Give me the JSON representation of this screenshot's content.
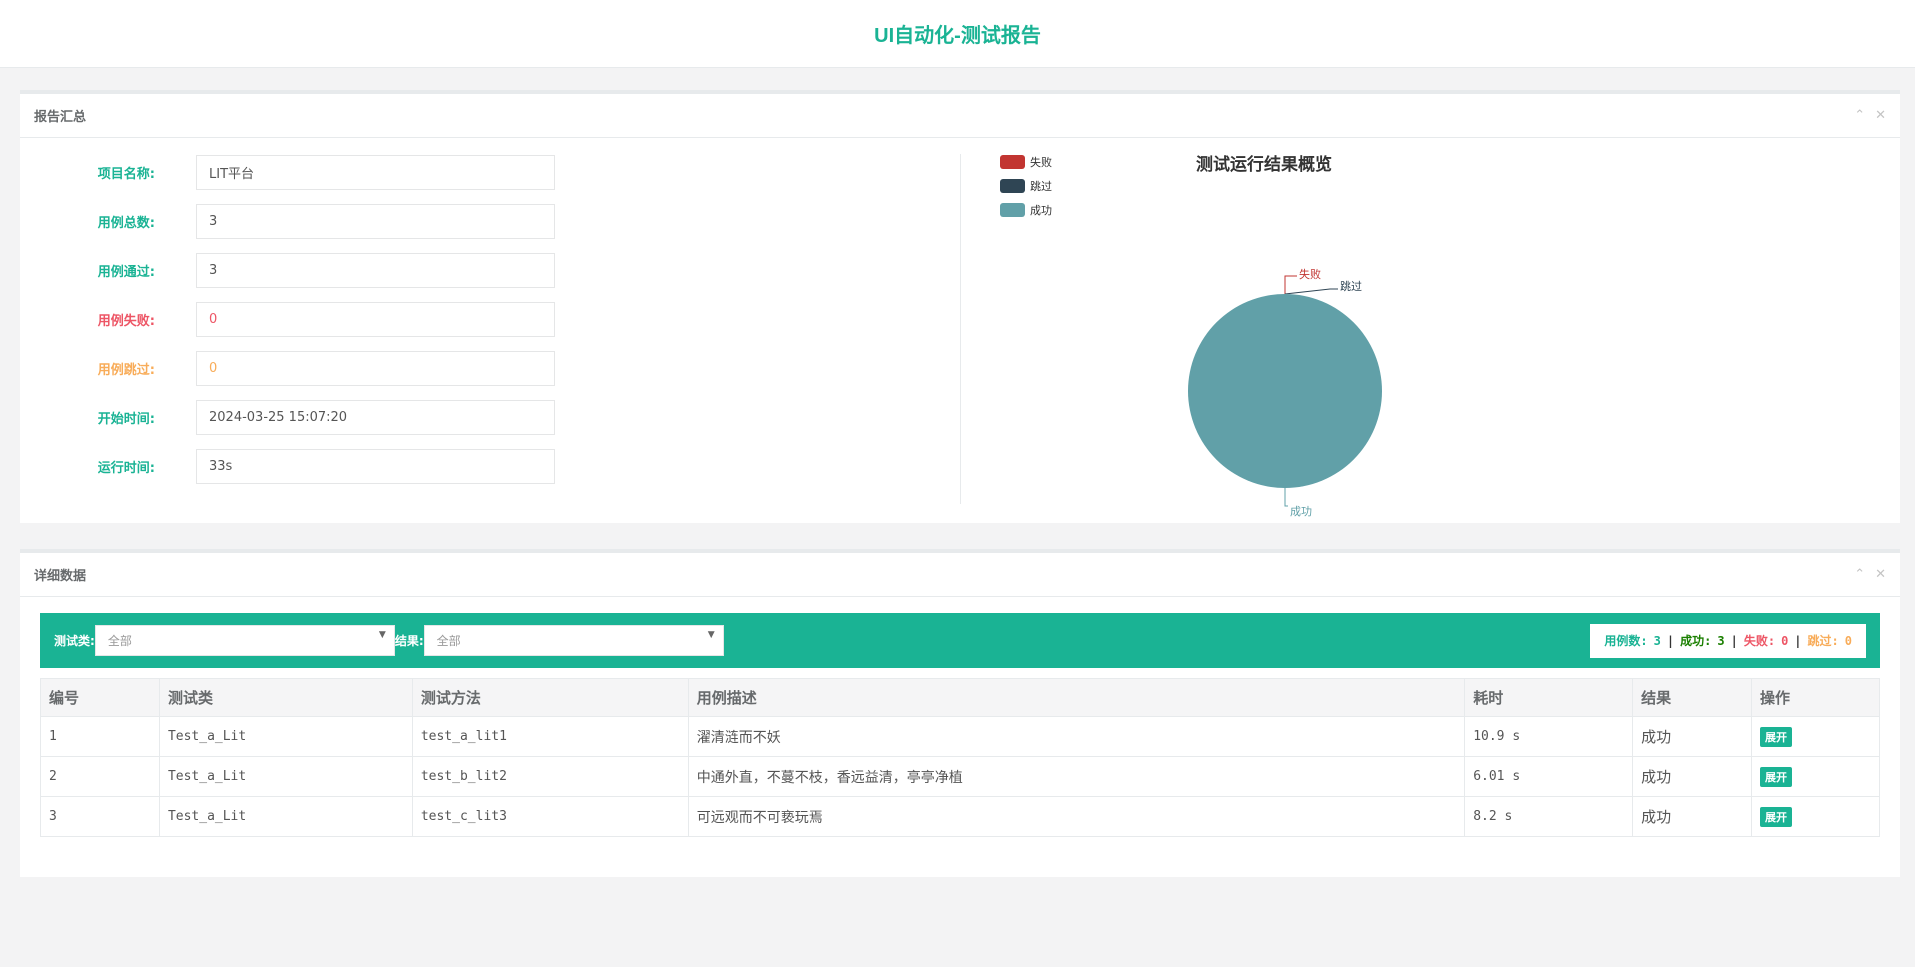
{
  "header": {
    "title": "UI自动化-测试报告"
  },
  "summary": {
    "title": "报告汇总",
    "fields": [
      {
        "label": "项目名称:",
        "value": "LIT平台"
      },
      {
        "label": "用例总数:",
        "value": "3"
      },
      {
        "label": "用例通过:",
        "value": "3"
      },
      {
        "label": "用例失败:",
        "value": "0"
      },
      {
        "label": "用例跳过:",
        "value": "0"
      },
      {
        "label": "开始时间:",
        "value": "2024-03-25 15:07:20"
      },
      {
        "label": "运行时间:",
        "value": "33s"
      }
    ]
  },
  "panel_tools": {
    "collapse": "⌃",
    "close": "✕"
  },
  "chart_data": {
    "type": "pie",
    "title": "测试运行结果概览",
    "legend_position": "top-left",
    "categories": [
      "失败",
      "跳过",
      "成功"
    ],
    "values": [
      0,
      0,
      3
    ],
    "colors": [
      "#c23531",
      "#2f4554",
      "#61a0a8"
    ]
  },
  "detail": {
    "title": "详细数据",
    "filters": {
      "class_label": "测试类:",
      "class_value": "全部",
      "result_label": "结果:",
      "result_value": "全部"
    },
    "stats": {
      "total_label": "用例数:",
      "total": "3",
      "pass_label": "成功:",
      "pass": "3",
      "fail_label": "失败:",
      "fail": "0",
      "skip_label": "跳过:",
      "skip": "0",
      "sep": "|"
    },
    "columns": [
      "编号",
      "测试类",
      "测试方法",
      "用例描述",
      "耗时",
      "结果",
      "操作"
    ],
    "rows": [
      {
        "id": "1",
        "cls": "Test_a_Lit",
        "method": "test_a_lit1",
        "desc": "濯清涟而不妖",
        "time": "10.9 s",
        "result": "成功",
        "action": "展开"
      },
      {
        "id": "2",
        "cls": "Test_a_Lit",
        "method": "test_b_lit2",
        "desc": "中通外直，不蔓不枝，香远益清，亭亭净植",
        "time": "6.01 s",
        "result": "成功",
        "action": "展开"
      },
      {
        "id": "3",
        "cls": "Test_a_Lit",
        "method": "test_c_lit3",
        "desc": "可远观而不可亵玩焉",
        "time": "8.2 s",
        "result": "成功",
        "action": "展开"
      }
    ]
  }
}
